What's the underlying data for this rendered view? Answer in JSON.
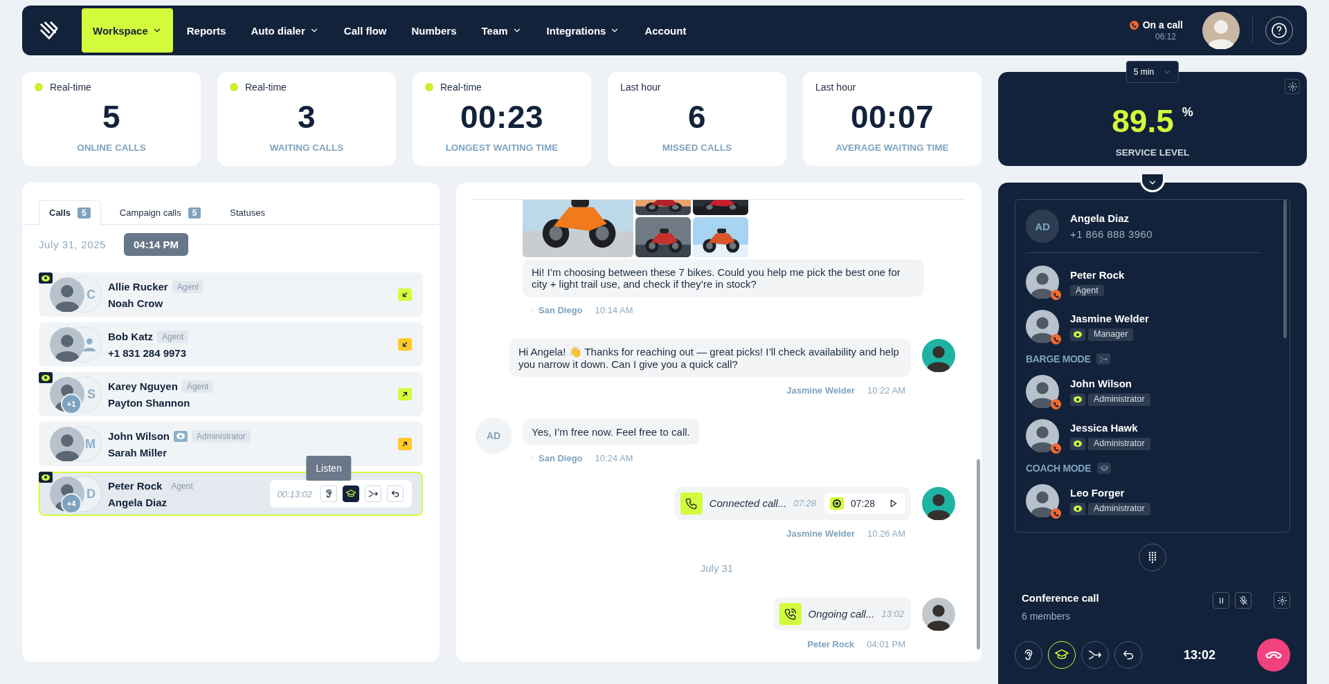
{
  "nav": {
    "items": [
      {
        "label": "Workspace",
        "selected": true,
        "dropdown": true
      },
      {
        "label": "Reports",
        "selected": false,
        "dropdown": false
      },
      {
        "label": "Auto dialer",
        "selected": false,
        "dropdown": true
      },
      {
        "label": "Call flow",
        "selected": false,
        "dropdown": false
      },
      {
        "label": "Numbers",
        "selected": false,
        "dropdown": false
      },
      {
        "label": "Team",
        "selected": false,
        "dropdown": true
      },
      {
        "label": "Integrations",
        "selected": false,
        "dropdown": true
      },
      {
        "label": "Account",
        "selected": false,
        "dropdown": false
      }
    ],
    "call_status": {
      "label": "On a call",
      "time": "06:12"
    }
  },
  "stats": [
    {
      "period": "Real-time",
      "live": true,
      "value": "5",
      "label": "ONLINE CALLS"
    },
    {
      "period": "Real-time",
      "live": true,
      "value": "3",
      "label": "WAITING CALLS"
    },
    {
      "period": "Real-time",
      "live": true,
      "value": "00:23",
      "label": "LONGEST WAITING TIME"
    },
    {
      "period": "Last hour",
      "live": false,
      "value": "6",
      "label": "MISSED CALLS"
    },
    {
      "period": "Last hour",
      "live": false,
      "value": "00:07",
      "label": "AVERAGE WAITING TIME"
    }
  ],
  "service_level": {
    "interval": "5 min",
    "value": "89.5",
    "unit": "%",
    "label": "SERVICE LEVEL"
  },
  "calls_panel": {
    "tabs": [
      {
        "label": "Calls",
        "count": "5",
        "selected": true
      },
      {
        "label": "Campaign calls",
        "count": "5",
        "selected": false
      },
      {
        "label": "Statuses",
        "selected": false
      }
    ],
    "date": "July 31, 2025",
    "time": "04:14 PM",
    "calls": [
      {
        "agent": "Allie Rucker",
        "role": "Agent",
        "contact": "Noah Crow",
        "initials": "C",
        "monitored": true,
        "eye_badge": false,
        "incoming": true,
        "color": "#d4fb3c",
        "selected": false
      },
      {
        "agent": "Bob Katz",
        "role": "Agent",
        "contact": "+1 831 284 9973",
        "monitored": false,
        "eye_badge": false,
        "incoming": true,
        "color": "#ffc928",
        "selected": false
      },
      {
        "agent": "Karey Nguyen",
        "role": "Agent",
        "contact": "Payton Shannon",
        "initials": "S",
        "extra": "+1",
        "monitored": true,
        "eye_badge": false,
        "incoming": false,
        "color": "#d4fb3c",
        "selected": false
      },
      {
        "agent": "John Wilson",
        "role": "Administrator",
        "contact": "Sarah Miller",
        "initials": "M",
        "monitored": false,
        "eye_badge": true,
        "incoming": false,
        "color": "#ffc928",
        "selected": false
      },
      {
        "agent": "Peter Rock",
        "role": "Agent",
        "contact": "Angela Diaz",
        "initials": "D",
        "extra": "+4",
        "monitored": true,
        "eye_badge": false,
        "selected": true,
        "timer": "00:13:02",
        "actions": [
          {
            "kind": "listen",
            "active": false,
            "tooltip": "Listen"
          },
          {
            "kind": "coach",
            "active": true
          },
          {
            "kind": "barge",
            "active": false
          },
          {
            "kind": "return",
            "active": false
          }
        ]
      }
    ]
  },
  "chat": {
    "messages": [
      {
        "kind": "media",
        "outgoing": false,
        "text": "Hi! I’m choosing between these 7 bikes. Could you help me pick the best one for city + light trail use, and check if they’re in stock?",
        "sender": "San Diego",
        "time": "10:14 AM"
      },
      {
        "kind": "text",
        "outgoing": true,
        "text": "Hi Angela! 👋  Thanks for reaching out — great picks! I’ll check availability and help you narrow it down. Can I give you a quick call?",
        "sender": "Jasmine Welder",
        "time": "10:22 AM"
      },
      {
        "kind": "text",
        "outgoing": false,
        "initials": "AD",
        "text": "Yes, I’m free now. Feel free to call.",
        "sender": "San Diego",
        "time": "10:24 AM"
      },
      {
        "kind": "call",
        "outgoing": true,
        "ongoing": false,
        "text": "Connected call...",
        "duration": "07:28",
        "recording": "07:28",
        "sender": "Jasmine Welder",
        "time": "10:26 AM"
      },
      {
        "kind": "date",
        "text": "July 31"
      },
      {
        "kind": "call",
        "outgoing": true,
        "ongoing": true,
        "text": "Ongoing call...",
        "duration": "13:02",
        "sender": "Peter Rock",
        "time": "04:01 PM"
      }
    ]
  },
  "conference": {
    "customer": {
      "initials": "AD",
      "name": "Angela Diaz",
      "phone": "+1 866 888 3960"
    },
    "participants": [
      {
        "kind": "member",
        "name": "Peter Rock",
        "role": "Agent",
        "monitoring": false
      },
      {
        "kind": "member",
        "name": "Jasmine Welder",
        "role": "Manager",
        "monitoring": true
      },
      {
        "kind": "barge_mode",
        "label": "BARGE MODE"
      },
      {
        "kind": "member",
        "name": "John Wilson",
        "role": "Administrator",
        "monitoring": true
      },
      {
        "kind": "member",
        "name": "Jessica Hawk",
        "role": "Administrator",
        "monitoring": true
      },
      {
        "kind": "coach_mode",
        "label": "COACH MODE"
      },
      {
        "kind": "member",
        "name": "Leo Forger",
        "role": "Administrator",
        "monitoring": true
      }
    ],
    "title": "Conference call",
    "members": "6 members",
    "timer": "13:02",
    "actions": [
      {
        "kind": "listen",
        "active": false
      },
      {
        "kind": "coach",
        "active": true
      },
      {
        "kind": "barge",
        "active": false
      },
      {
        "kind": "return",
        "active": false
      }
    ]
  }
}
